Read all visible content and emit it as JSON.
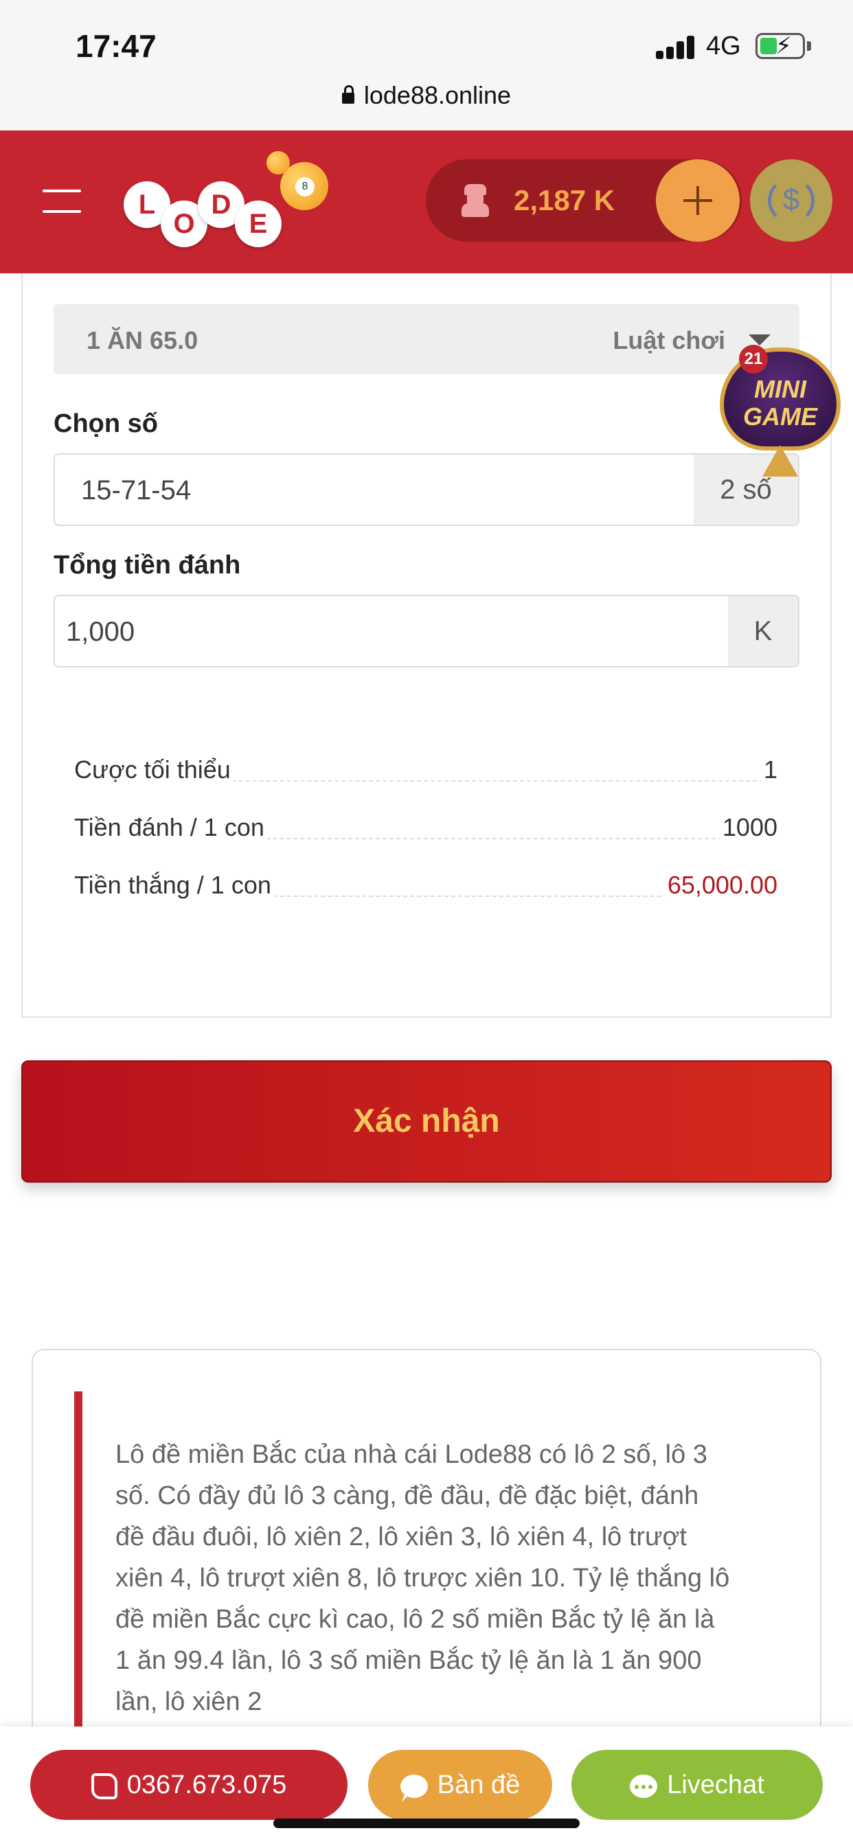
{
  "status_bar": {
    "time": "17:47",
    "network": "4G",
    "url": "lode88.online"
  },
  "header": {
    "logo_letters": [
      "L",
      "O",
      "D",
      "E"
    ],
    "balance": "2,187 K",
    "icons": [
      "menu-icon",
      "spy-icon",
      "plus-icon",
      "exchange-icon"
    ]
  },
  "rule": {
    "odds": "1 ĂN 65.0",
    "link": "Luật chơi"
  },
  "number_select": {
    "label": "Chọn số",
    "value": "15-71-54",
    "suffix": "2 số"
  },
  "total_bet": {
    "label": "Tổng tiền đánh",
    "value": "1,000",
    "suffix": "K"
  },
  "summary": [
    {
      "label": "Cược tối thiểu",
      "value": "1"
    },
    {
      "label": "Tiền đánh / 1 con",
      "value": "1000"
    },
    {
      "label": "Tiền thắng / 1 con",
      "value": "65,000.00"
    }
  ],
  "mini_game": {
    "badge": "21",
    "line1": "MINI",
    "line2": "GAME"
  },
  "confirm_button": "Xác nhận",
  "info_text": "Lô đề miền Bắc của nhà cái Lode88 có lô 2 số, lô 3 số. Có đầy đủ lô 3 càng, đề đầu, đề đặc biệt, đánh đề đầu đuôi, lô xiên 2, lô xiên 3, lô xiên 4, lô trượt xiên 4, lô trượt xiên 8, lô trược xiên 10. Tỷ lệ thắng lô đề miền Bắc cực kì cao, lô 2 số miền Bắc tỷ lệ ăn là 1 ăn 99.4 lần, lô 3 số miền Bắc tỷ lệ ăn là 1 ăn 900 lần, lô xiên 2",
  "bottom_bar": {
    "phone": "0367.673.075",
    "ban_de": "Bàn đề",
    "livechat": "Livechat"
  },
  "colors": {
    "brand_red": "#c4252f",
    "gold": "#f0a14a",
    "win_red": "#b5171f",
    "chat_green": "#8fbf3a"
  }
}
